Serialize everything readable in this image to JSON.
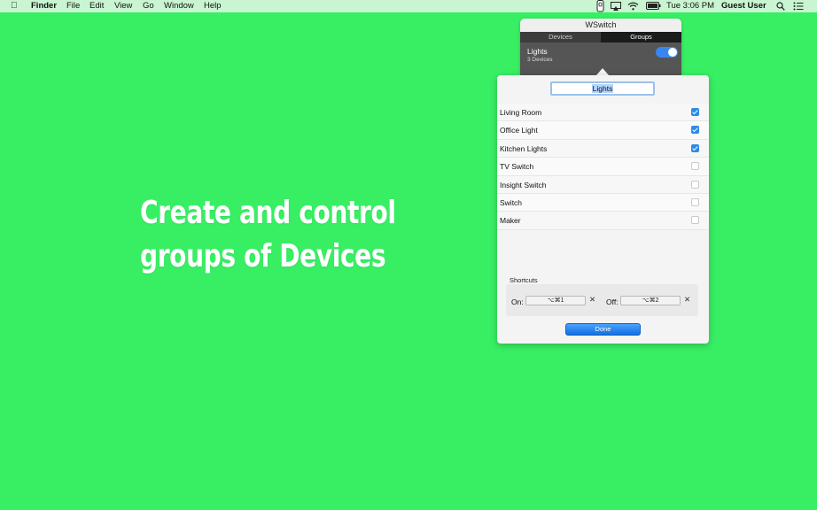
{
  "menubar": {
    "apple_glyph": "",
    "items": [
      "Finder",
      "File",
      "Edit",
      "View",
      "Go",
      "Window",
      "Help"
    ],
    "clock": "Tue 3:06 PM",
    "user": "Guest User"
  },
  "headline": {
    "line1": "Create and control",
    "line2": "groups of Devices"
  },
  "popover": {
    "title": "WSwitch",
    "tabs": [
      "Devices",
      "Groups"
    ],
    "active_tab": "Groups",
    "group": {
      "name": "Lights",
      "subtitle": "3 Devices",
      "enabled": true
    }
  },
  "editor": {
    "group_name": "Lights",
    "devices": [
      {
        "label": "Living Room",
        "checked": true
      },
      {
        "label": "Office  Light",
        "checked": true
      },
      {
        "label": "Kitchen Lights",
        "checked": true
      },
      {
        "label": "TV Switch",
        "checked": false
      },
      {
        "label": "Insight  Switch",
        "checked": false
      },
      {
        "label": "Switch",
        "checked": false
      },
      {
        "label": "Maker",
        "checked": false
      }
    ],
    "shortcuts": {
      "label": "Shortcuts",
      "on_label": "On:",
      "on_value": "⌥⌘1",
      "off_label": "Off:",
      "off_value": "⌥⌘2",
      "clear_glyph": "✕"
    },
    "done_label": "Done"
  },
  "colors": {
    "background": "#38ef64",
    "accent": "#2f8ae8"
  }
}
